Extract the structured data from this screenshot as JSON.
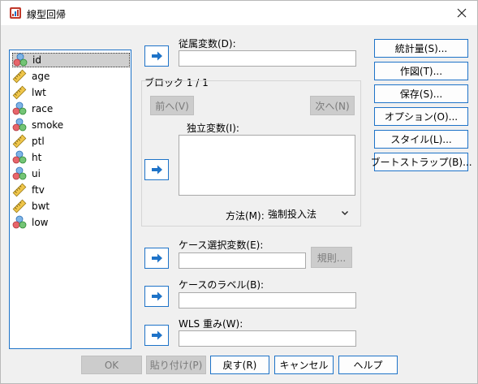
{
  "window": {
    "title": "線型回帰"
  },
  "variables": [
    {
      "name": "id",
      "type": "nominal"
    },
    {
      "name": "age",
      "type": "scale"
    },
    {
      "name": "lwt",
      "type": "scale"
    },
    {
      "name": "race",
      "type": "nominal"
    },
    {
      "name": "smoke",
      "type": "nominal"
    },
    {
      "name": "ptl",
      "type": "scale"
    },
    {
      "name": "ht",
      "type": "nominal"
    },
    {
      "name": "ui",
      "type": "nominal"
    },
    {
      "name": "ftv",
      "type": "scale"
    },
    {
      "name": "bwt",
      "type": "scale"
    },
    {
      "name": "low",
      "type": "nominal"
    }
  ],
  "dependent": {
    "label": "従属変数(D):",
    "value": ""
  },
  "block": {
    "label": "ブロック 1 / 1",
    "prev": "前へ(V)",
    "next": "次へ(N)",
    "independent_label": "独立変数(I):",
    "method_label": "方法(M):",
    "method_value": "強制投入法"
  },
  "case_selection": {
    "label": "ケース選択変数(E):",
    "rule_button": "規則..."
  },
  "case_labels": {
    "label": "ケースのラベル(B):"
  },
  "wls": {
    "label": "WLS 重み(W):"
  },
  "side_buttons": [
    "統計量(S)...",
    "作図(T)...",
    "保存(S)...",
    "オプション(O)...",
    "スタイル(L)...",
    "ブートストラップ(B)..."
  ],
  "bottom_buttons": {
    "ok": "OK",
    "paste": "貼り付け(P)",
    "reset": "戻す(R)",
    "cancel": "キャンセル",
    "help": "ヘルプ"
  },
  "colors": {
    "accent": "#1e73c8",
    "selected": "#cfcfcf",
    "disabled": "#cccccc"
  }
}
